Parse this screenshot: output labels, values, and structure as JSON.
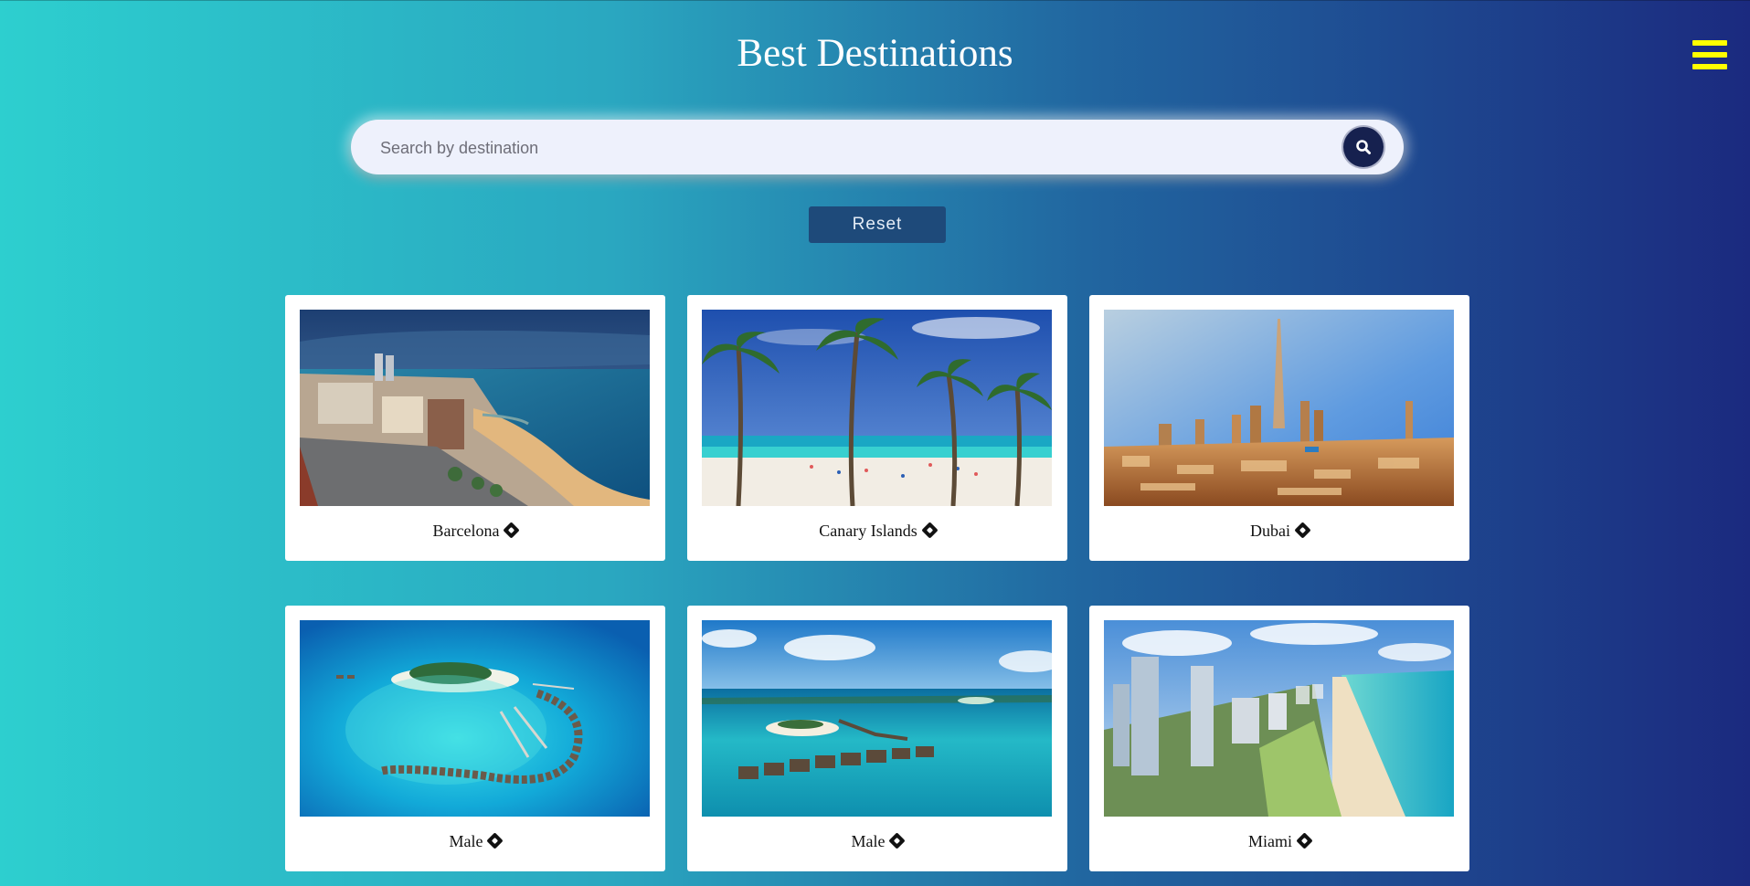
{
  "header": {
    "title": "Best Destinations",
    "menu_icon": "hamburger-menu-icon",
    "menu_color": "#ffff00"
  },
  "search": {
    "placeholder": "Search by destination",
    "value": "",
    "button_icon": "search-icon"
  },
  "reset": {
    "label": "Reset"
  },
  "destinations": [
    {
      "name": "Barcelona",
      "icon": "directions-sign-icon",
      "image": "Barcelona beach and city skyline"
    },
    {
      "name": "Canary Islands",
      "icon": "directions-sign-icon",
      "image": "palm trees on sandy beach"
    },
    {
      "name": "Dubai",
      "icon": "directions-sign-icon",
      "image": "Dubai skyline at sunset"
    },
    {
      "name": "Male",
      "icon": "directions-sign-icon",
      "image": "Maldives island with overwater villas"
    },
    {
      "name": "Male",
      "icon": "directions-sign-icon",
      "image": "Maldives overwater bungalows"
    },
    {
      "name": "Miami",
      "icon": "directions-sign-icon",
      "image": "Miami beach with high-rise buildings"
    }
  ],
  "colors": {
    "gradient_start": "#2dcfcf",
    "gradient_end": "#1b2a7f",
    "search_button": "#16214f",
    "reset_button": "#1e4a7a"
  }
}
